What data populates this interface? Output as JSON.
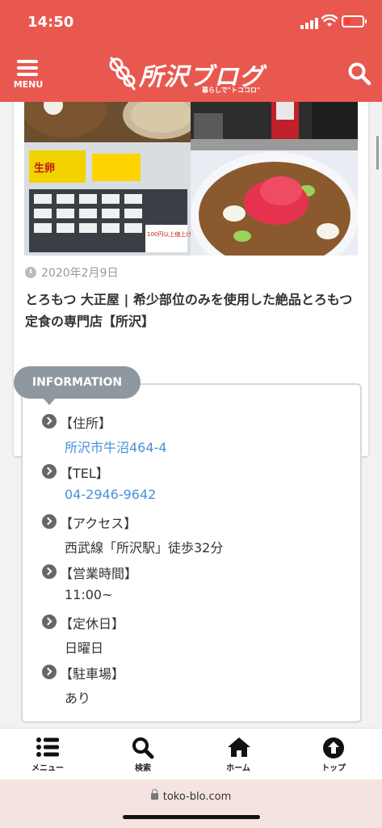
{
  "status_bar": {
    "time": "14:50"
  },
  "header": {
    "menu_label": "MENU",
    "logo_title": "所沢ブログ",
    "logo_tagline": "暮らしで\"トココロ\"",
    "brand_color": "#e8584f"
  },
  "article_card": {
    "date": "2020年2月9日",
    "headline": "とろもつ 大正屋 | 希少部位のみを使用した絶品とろもつ定食の専門店【所沢】",
    "photo_sign_text": "100円以上値上げ"
  },
  "information": {
    "heading": "INFORMATION",
    "items": [
      {
        "label": "【住所】",
        "value": "所沢市牛沼464-4",
        "is_link": true
      },
      {
        "label": "【TEL】",
        "value": "04-2946-9642",
        "is_link": true
      },
      {
        "label": "【アクセス】",
        "value": "西武線「所沢駅」徒歩32分",
        "is_link": false
      },
      {
        "label": "【営業時間】",
        "value": "11:00~",
        "is_link": false
      },
      {
        "label": "【定休日】",
        "value": "日曜日",
        "is_link": false
      },
      {
        "label": "【駐車場】",
        "value": "あり",
        "is_link": false
      }
    ]
  },
  "bottom_nav": {
    "items": [
      {
        "label": "メニュー",
        "icon": "list-icon"
      },
      {
        "label": "検索",
        "icon": "search-icon"
      },
      {
        "label": "ホーム",
        "icon": "home-icon"
      },
      {
        "label": "トップ",
        "icon": "arrow-up-circle-icon"
      }
    ]
  },
  "url_bar": {
    "url": "toko-blo.com"
  }
}
